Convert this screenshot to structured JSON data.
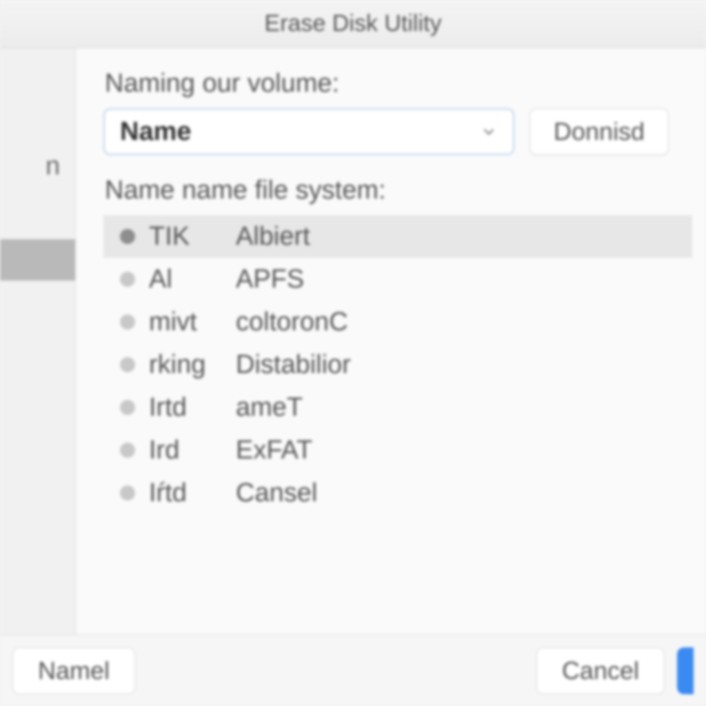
{
  "title": "Erase Disk Utility",
  "sidebar": {
    "fragment": "n"
  },
  "main": {
    "volume_label": "Naming our volume:",
    "volume_combo": {
      "value": "Name"
    },
    "donnisd_button": "Donnisd",
    "fs_label": "Name name file system:",
    "fs_items": [
      {
        "c1": "TIK",
        "c2": "Albiert",
        "selected": true
      },
      {
        "c1": "Al",
        "c2": "APFS",
        "selected": false
      },
      {
        "c1": "mivt",
        "c2": "coltoronC",
        "selected": false
      },
      {
        "c1": "rking",
        "c2": "Distabilior",
        "selected": false
      },
      {
        "c1": "Irtd",
        "c2": "ameT",
        "selected": false
      },
      {
        "c1": "Ird",
        "c2": "ExFAT",
        "selected": false
      },
      {
        "c1": "Iŕtd",
        "c2": "Cansel",
        "selected": false
      }
    ]
  },
  "footer": {
    "left_button": "Namel",
    "cancel_button": "Cancel"
  }
}
